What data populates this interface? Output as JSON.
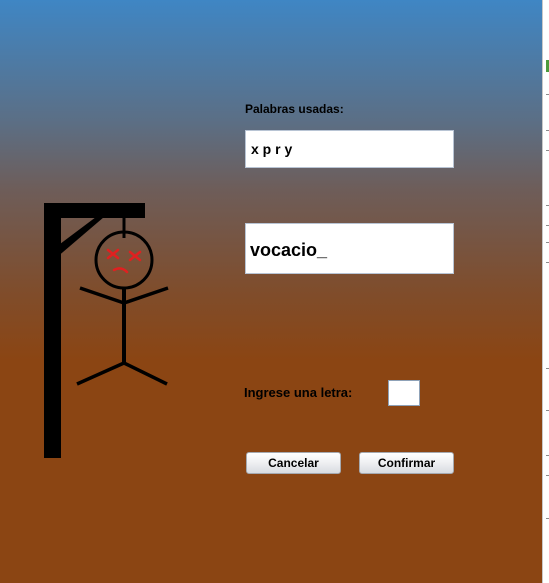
{
  "used_words": {
    "label": "Palabras usadas:",
    "value": "x p r y"
  },
  "word": {
    "value": "vocacio_"
  },
  "letter_input": {
    "label": "Ingrese una letra:",
    "value": ""
  },
  "buttons": {
    "cancel": "Cancelar",
    "confirm": "Confirmar"
  },
  "colors": {
    "background_top": "#3f86c4",
    "background_bottom": "#8b4513",
    "figure_eyes": "#e02020"
  },
  "hangman": {
    "parts_shown": [
      "head",
      "body",
      "left-arm",
      "right-arm",
      "left-leg",
      "right-leg"
    ],
    "eyes": "x-x"
  }
}
